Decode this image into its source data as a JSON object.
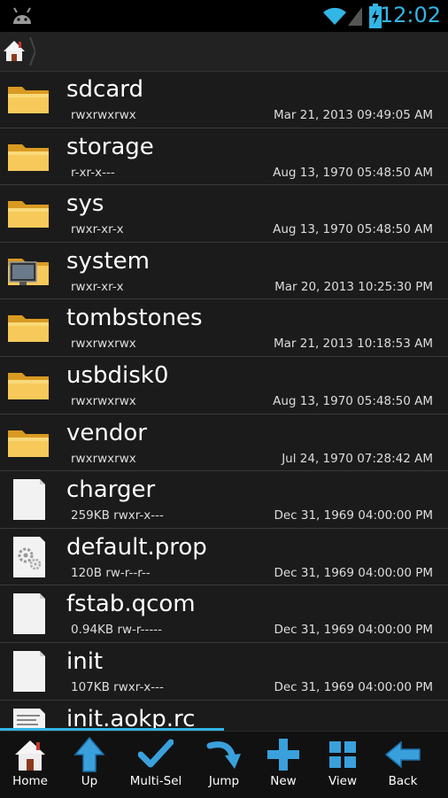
{
  "status_bar": {
    "time": "12:02",
    "icons": [
      "android-icon",
      "wifi-icon",
      "signal-icon",
      "battery-charging-icon"
    ],
    "accent_color": "#33b5e5"
  },
  "path_bar": {
    "icon": "home-icon"
  },
  "files": [
    {
      "name": "sdcard",
      "meta": "rwxrwxrwx",
      "date": "Mar 21, 2013 09:49:05 AM",
      "icon": "folder-icon"
    },
    {
      "name": "storage",
      "meta": "r-xr-x---",
      "date": "Aug 13, 1970 05:48:50 AM",
      "icon": "folder-icon"
    },
    {
      "name": "sys",
      "meta": "rwxr-xr-x",
      "date": "Aug 13, 1970 05:48:50 AM",
      "icon": "folder-icon"
    },
    {
      "name": "system",
      "meta": "rwxr-xr-x",
      "date": "Mar 20, 2013 10:25:30 PM",
      "icon": "system-folder-icon"
    },
    {
      "name": "tombstones",
      "meta": "rwxrwxrwx",
      "date": "Mar 21, 2013 10:18:53 AM",
      "icon": "folder-icon"
    },
    {
      "name": "usbdisk0",
      "meta": "rwxrwxrwx",
      "date": "Aug 13, 1970 05:48:50 AM",
      "icon": "folder-icon"
    },
    {
      "name": "vendor",
      "meta": "rwxrwxrwx",
      "date": "Jul 24, 1970 07:28:42 AM",
      "icon": "folder-icon"
    },
    {
      "name": "charger",
      "meta": "259KB rwxr-x---",
      "date": "Dec 31, 1969 04:00:00 PM",
      "icon": "file-icon"
    },
    {
      "name": "default.prop",
      "meta": "120B rw-r--r--",
      "date": "Dec 31, 1969 04:00:00 PM",
      "icon": "settings-file-icon"
    },
    {
      "name": "fstab.qcom",
      "meta": "0.94KB rw-r-----",
      "date": "Dec 31, 1969 04:00:00 PM",
      "icon": "file-icon"
    },
    {
      "name": "init",
      "meta": "107KB rwxr-x---",
      "date": "Dec 31, 1969 04:00:00 PM",
      "icon": "file-icon"
    },
    {
      "name": "init.aokp.rc",
      "meta": "",
      "date": "",
      "icon": "text-file-icon"
    }
  ],
  "toolbar": [
    {
      "label": "Home",
      "icon": "home-icon"
    },
    {
      "label": "Up",
      "icon": "up-arrow-icon"
    },
    {
      "label": "Multi-Sel",
      "icon": "checkmark-icon"
    },
    {
      "label": "Jump",
      "icon": "jump-arrow-icon"
    },
    {
      "label": "New",
      "icon": "plus-icon"
    },
    {
      "label": "View",
      "icon": "grid-view-icon"
    },
    {
      "label": "Back",
      "icon": "back-arrow-icon"
    }
  ]
}
